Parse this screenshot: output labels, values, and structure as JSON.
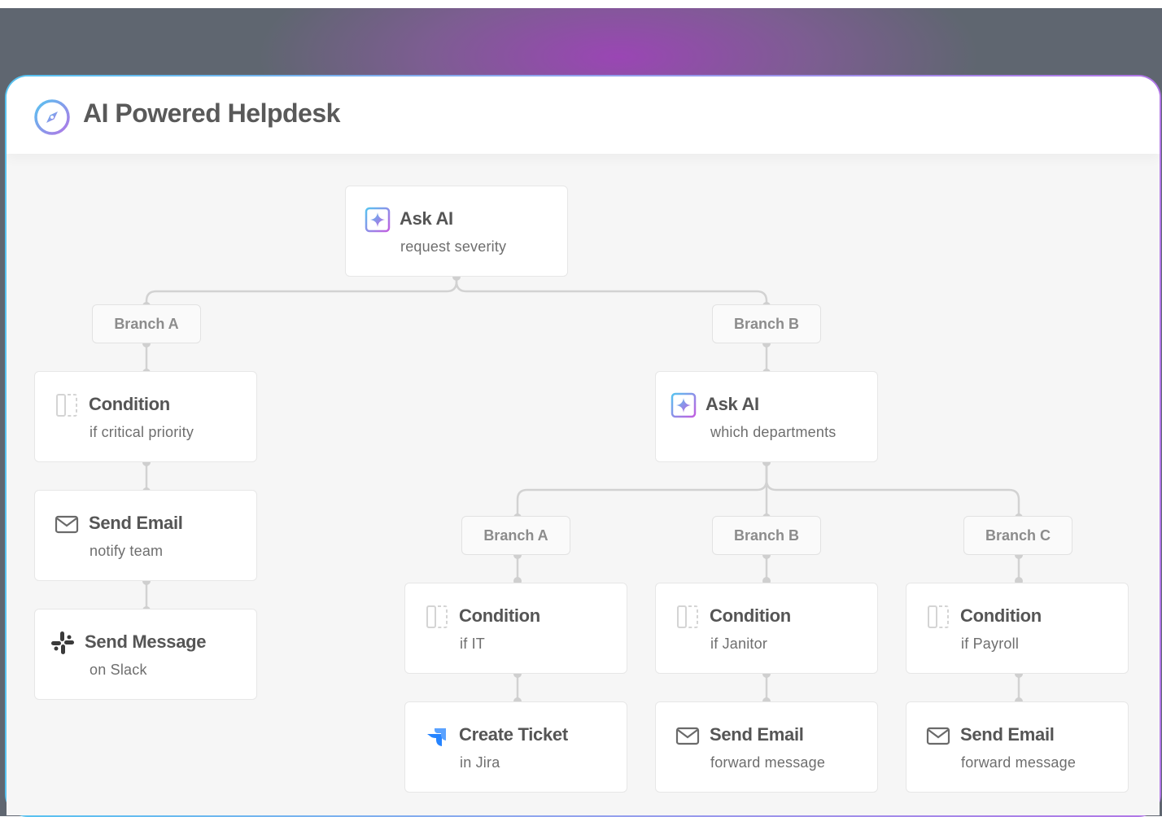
{
  "header": {
    "title": "AI Powered Helpdesk",
    "icon": "compass-icon"
  },
  "colors": {
    "accent_start": "#57c3f0",
    "accent_end": "#b176e6",
    "jira_blue": "#2684ff",
    "wire": "#d2d2d2"
  },
  "nodes": {
    "root": {
      "title": "Ask AI",
      "subtitle": "request severity",
      "icon": "ai-sparkle-icon"
    },
    "branch_a": {
      "label": "Branch A"
    },
    "branch_b": {
      "label": "Branch B"
    },
    "a_condition": {
      "title": "Condition",
      "subtitle": "if critical priority",
      "icon": "condition-icon"
    },
    "a_email": {
      "title": "Send Email",
      "subtitle": "notify team",
      "icon": "mail-icon"
    },
    "a_slack": {
      "title": "Send Message",
      "subtitle": "on Slack",
      "icon": "slack-icon"
    },
    "b_ask": {
      "title": "Ask AI",
      "subtitle": "which departments",
      "icon": "ai-sparkle-icon"
    },
    "b_branch_a": {
      "label": "Branch A"
    },
    "b_branch_b": {
      "label": "Branch B"
    },
    "b_branch_c": {
      "label": "Branch C"
    },
    "b_cond_it": {
      "title": "Condition",
      "subtitle": "if IT",
      "icon": "condition-icon"
    },
    "b_cond_janitor": {
      "title": "Condition",
      "subtitle": "if Janitor",
      "icon": "condition-icon"
    },
    "b_cond_payroll": {
      "title": "Condition",
      "subtitle": "if Payroll",
      "icon": "condition-icon"
    },
    "b_jira": {
      "title": "Create Ticket",
      "subtitle": "in Jira",
      "icon": "jira-icon"
    },
    "b_email_janitor": {
      "title": "Send Email",
      "subtitle": "forward message",
      "icon": "mail-icon"
    },
    "b_email_payroll": {
      "title": "Send Email",
      "subtitle": "forward message",
      "icon": "mail-icon"
    }
  }
}
